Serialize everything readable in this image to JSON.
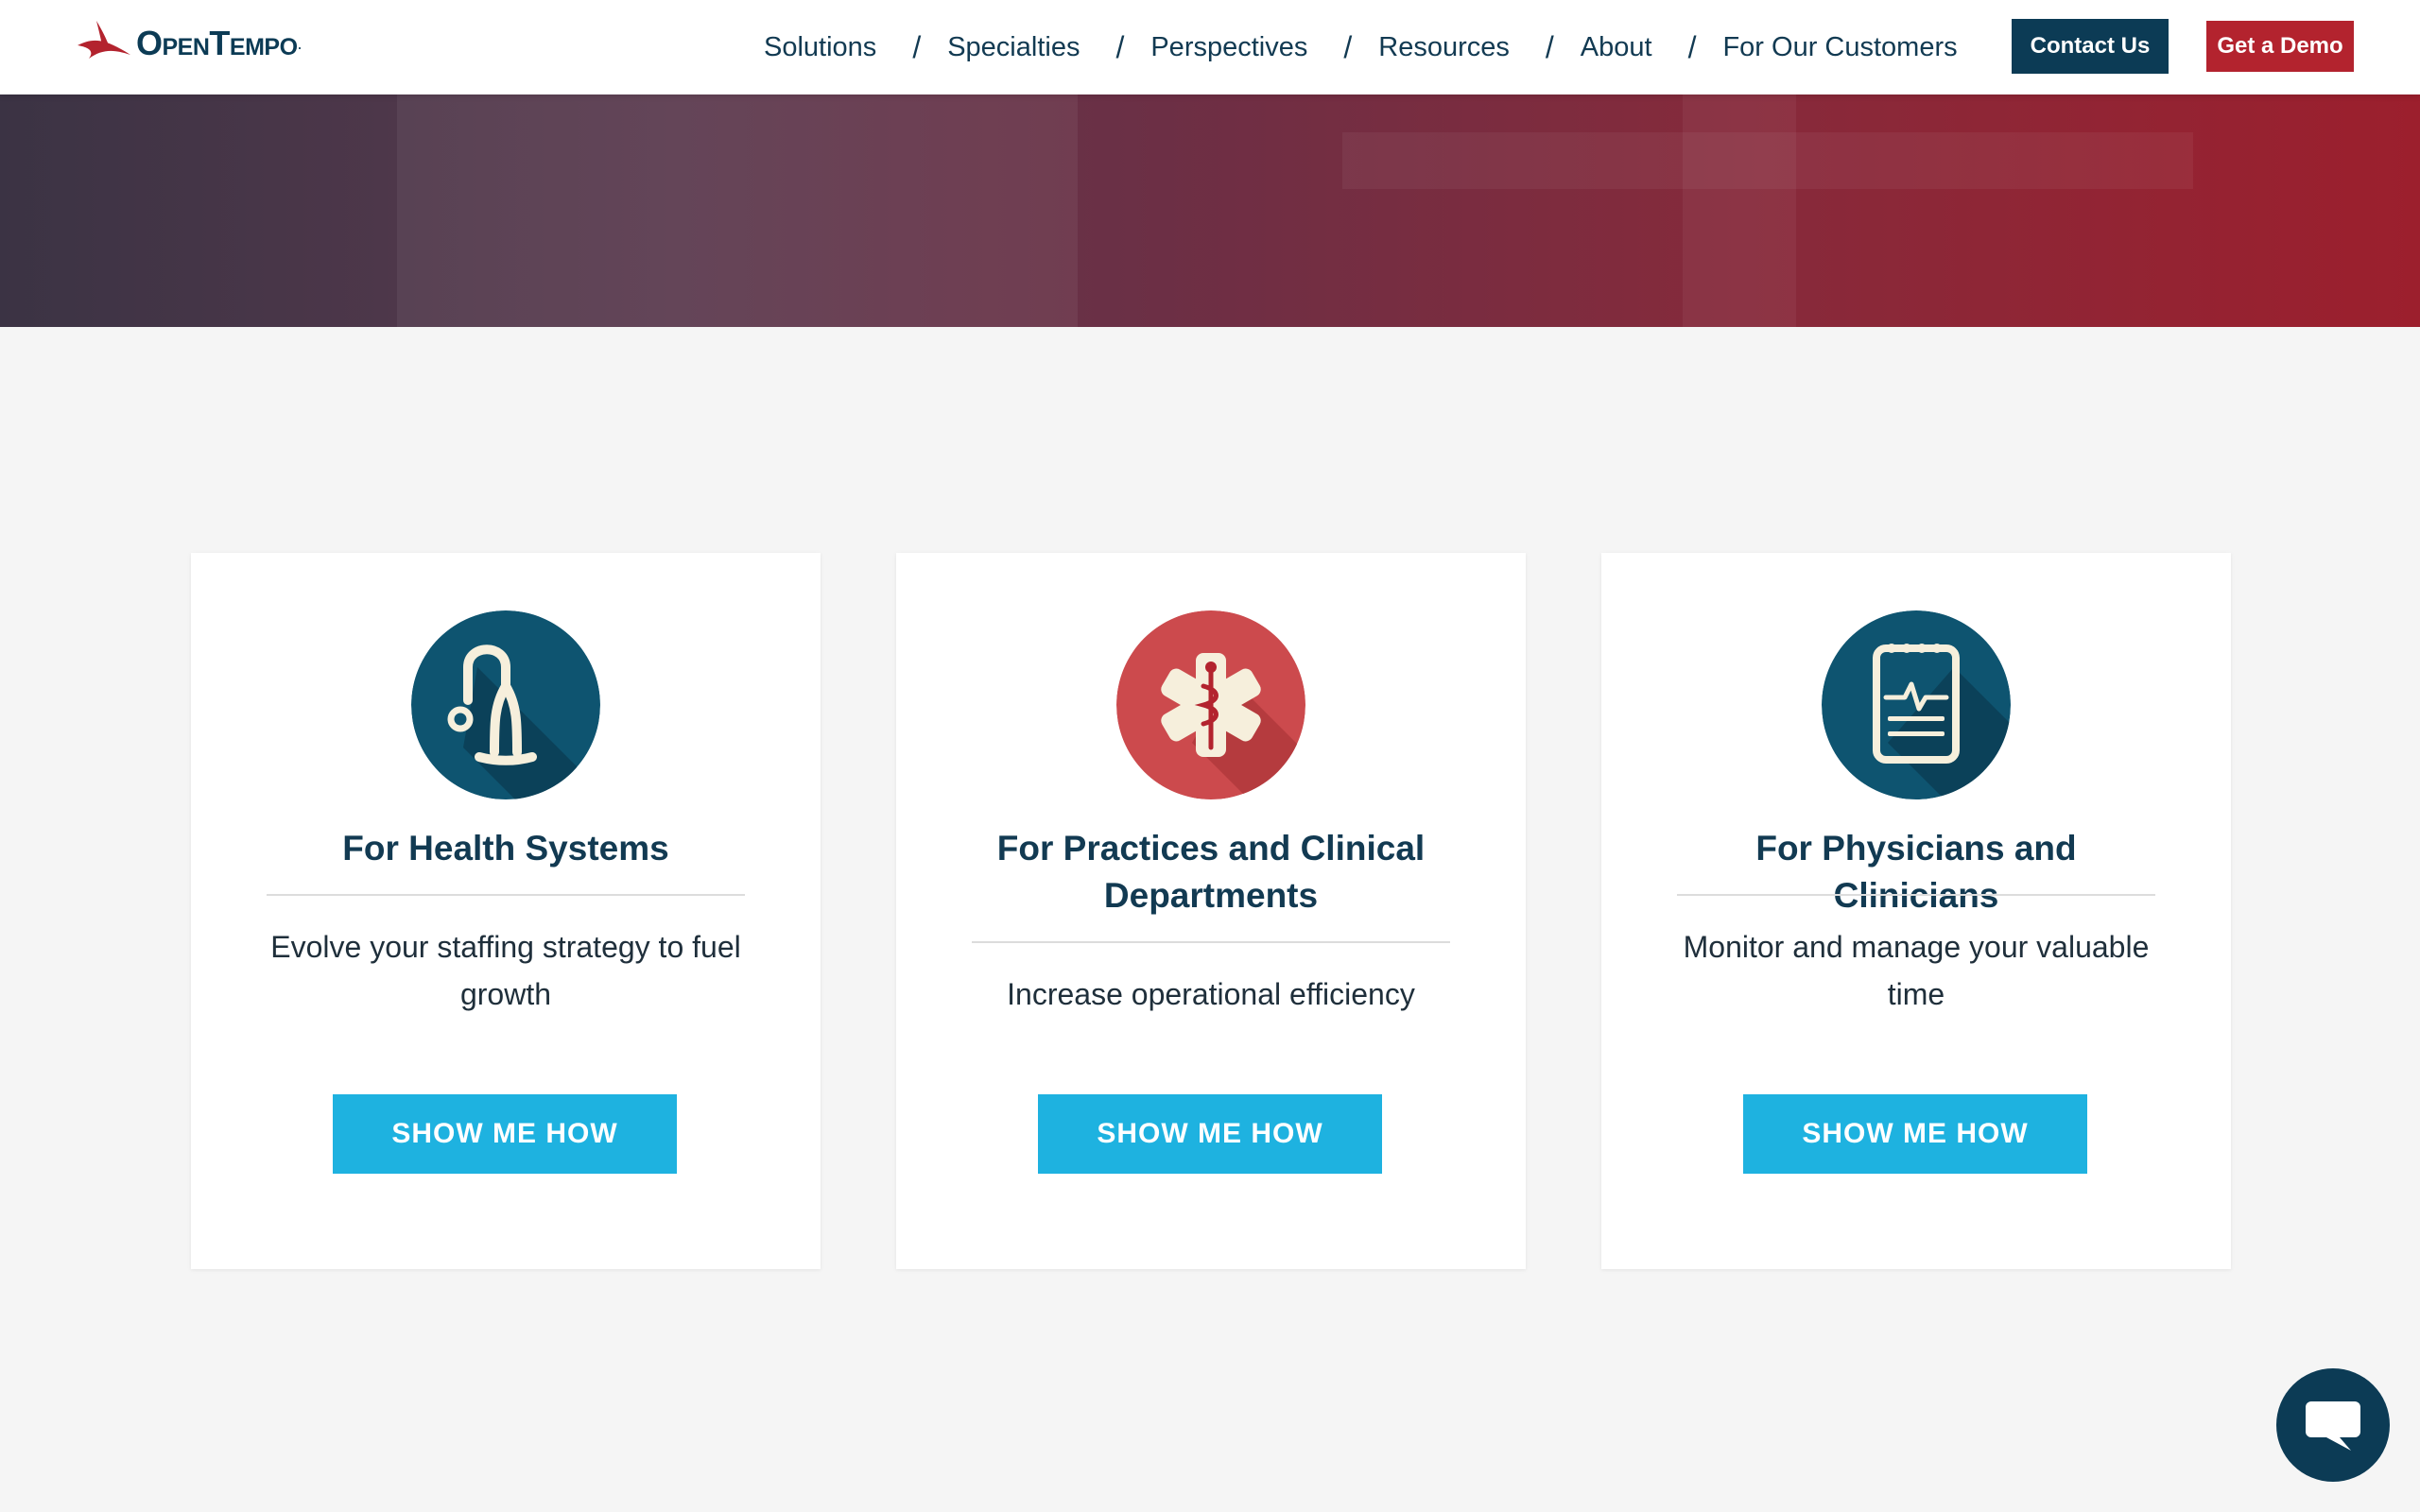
{
  "header": {
    "logo_text": "OpenTempo",
    "logo_mark": ".",
    "nav": [
      {
        "label": "Solutions"
      },
      {
        "label": "Specialties"
      },
      {
        "label": "Perspectives"
      },
      {
        "label": "Resources"
      },
      {
        "label": "About"
      },
      {
        "label": "For Our Customers"
      }
    ],
    "separator": "/",
    "contact_label": "Contact Us",
    "demo_label": "Get a Demo"
  },
  "cards": [
    {
      "title": "For Health Systems",
      "description": "Evolve your staffing strategy to fuel growth",
      "button": "SHOW ME HOW",
      "icon": "stethoscope-icon",
      "icon_color": "#0e5470"
    },
    {
      "title": "For Practices and Clinical Departments",
      "description": "Increase operational efficiency",
      "button": "SHOW ME HOW",
      "icon": "medical-star-icon",
      "icon_color": "#cc4a4d"
    },
    {
      "title": "For Physicians and Clinicians",
      "description": "Monitor and manage your valuable time",
      "button": "SHOW ME HOW",
      "icon": "clipboard-heartbeat-icon",
      "icon_color": "#0e5470"
    }
  ],
  "colors": {
    "brand_navy": "#0c3b55",
    "brand_red": "#b3232e",
    "button_blue": "#1eb2e0"
  },
  "chat": {
    "icon": "chat-bubble-icon"
  }
}
